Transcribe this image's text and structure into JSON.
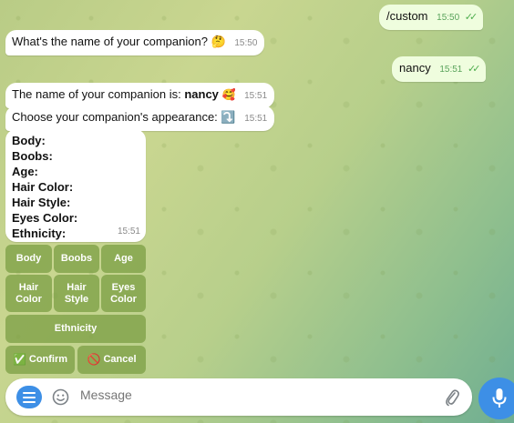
{
  "messages": {
    "m1": {
      "text": "/custom",
      "time": "15:50"
    },
    "m2": {
      "text": "What's the name of your companion? 🤔",
      "time": "15:50"
    },
    "m3": {
      "text": "nancy",
      "time": "15:51"
    },
    "m4": {
      "prefix": "The name of your companion is: ",
      "name": "nancy",
      "emoji": "🥰",
      "time": "15:51"
    },
    "m5": {
      "text": "Choose your companion's appearance: ⤵️",
      "time": "15:51"
    },
    "m6": {
      "lines": [
        "Body:",
        "Boobs:",
        "Age:",
        "Hair Color:",
        "Hair Style:",
        "Eyes Color:",
        "Ethnicity:"
      ],
      "time": "15:51"
    }
  },
  "keyboard": {
    "body": "Body",
    "boobs": "Boobs",
    "age": "Age",
    "hair_color": "Hair Color",
    "hair_style": "Hair Style",
    "eyes_color": "Eyes Color",
    "ethnicity": "Ethnicity",
    "confirm": "Confirm",
    "confirm_icon": "✅",
    "cancel": "Cancel",
    "cancel_icon": "🚫"
  },
  "input": {
    "placeholder": "Message"
  },
  "icons": {
    "menu": "menu-icon",
    "emoji": "emoji-icon",
    "attach": "paperclip-icon",
    "mic": "microphone-icon"
  },
  "colors": {
    "accent": "#3d8fe6",
    "outgoing": "#effdde",
    "keyboard": "#7da046"
  }
}
